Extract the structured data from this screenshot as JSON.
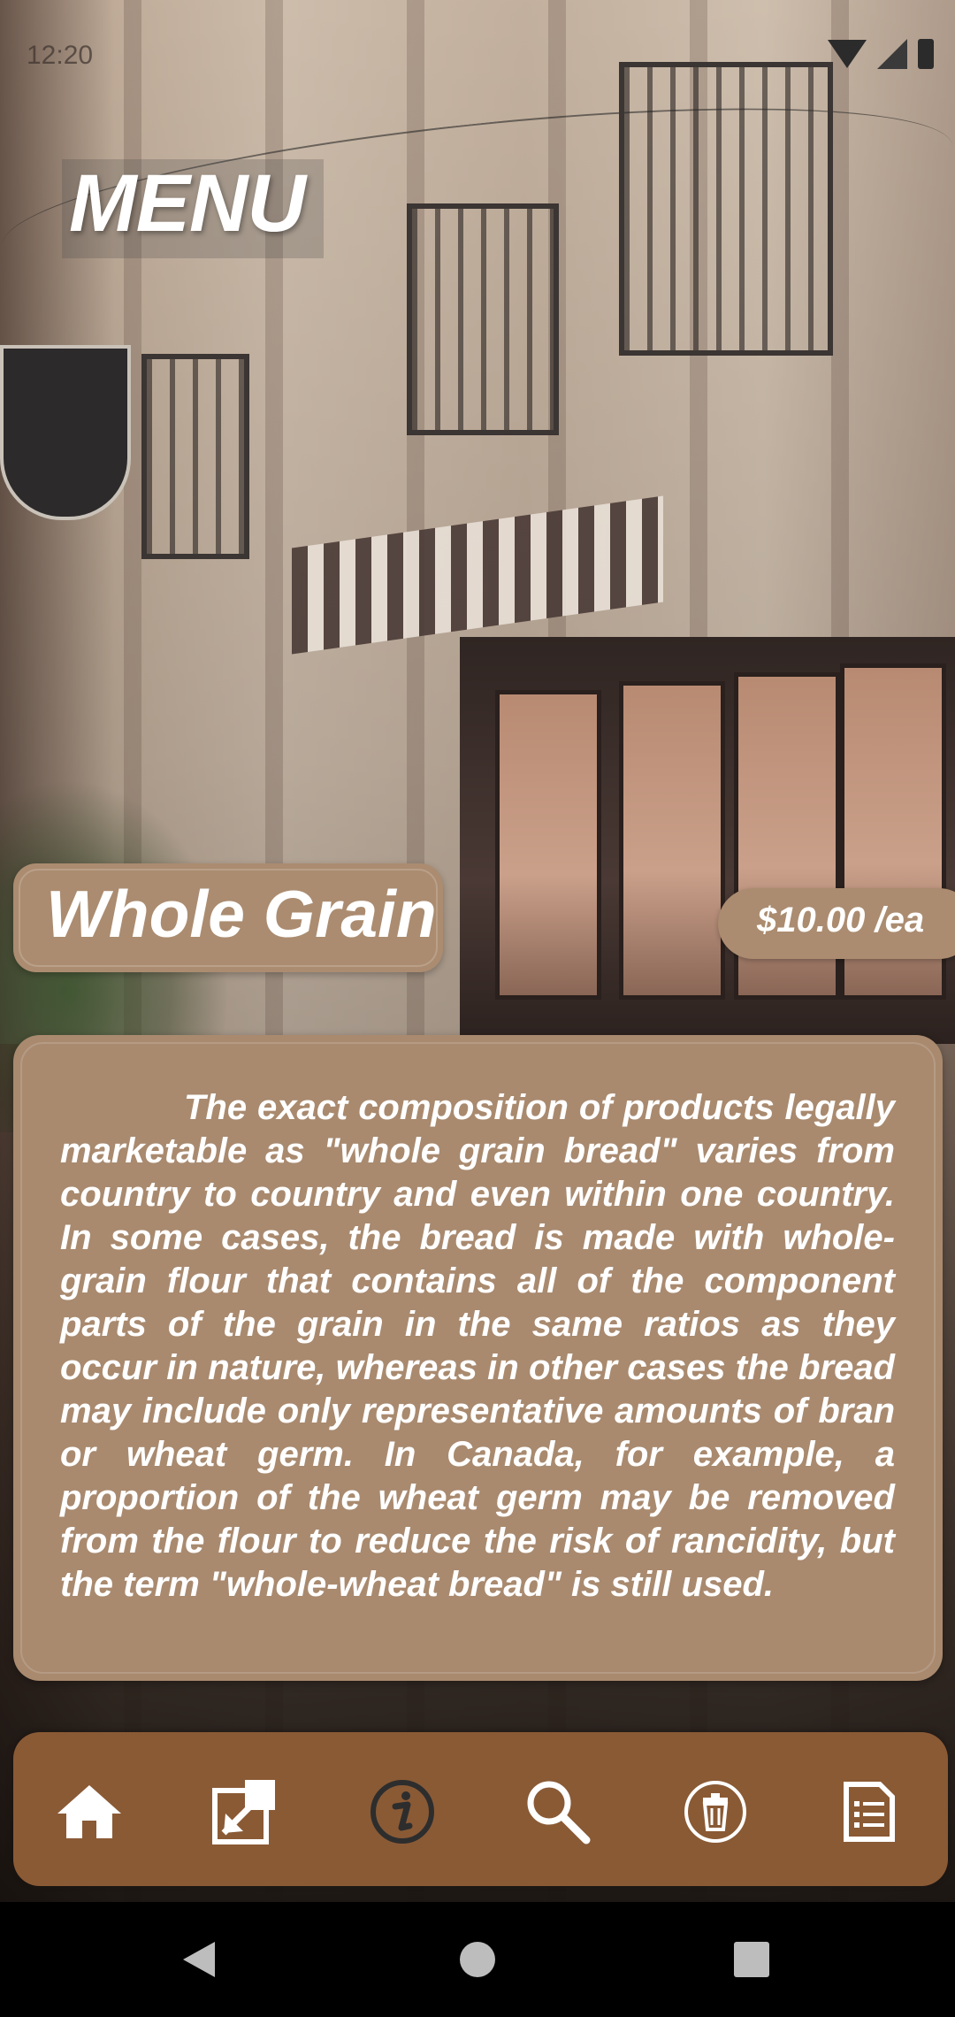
{
  "status_bar": {
    "time": "12:20",
    "icons": [
      "wifi-icon",
      "signal-icon",
      "battery-icon"
    ]
  },
  "header": {
    "title": "MENU"
  },
  "item": {
    "name": "Whole Grain",
    "price": "$10.00 /ea",
    "description": "The exact composition of products legally marketable as \"whole grain bread\" varies from country to country and even within one country. In some cases, the bread is made with whole-grain flour that contains all of the component parts of the grain in the same ratios as they occur in nature, whereas in other cases the bread may include only representative amounts of bran or wheat germ. In Canada, for example, a proportion of the wheat germ may be removed from the flour to reduce the risk of rancidity, but the term \"whole-wheat bread\" is still used."
  },
  "toolbar": {
    "buttons": [
      {
        "icon": "home-icon"
      },
      {
        "icon": "open-external-icon"
      },
      {
        "icon": "info-icon"
      },
      {
        "icon": "search-icon"
      },
      {
        "icon": "trash-icon"
      },
      {
        "icon": "checklist-icon"
      }
    ]
  },
  "nav_bar": {
    "buttons": [
      "back-icon",
      "home-circle-icon",
      "recents-icon"
    ]
  },
  "colors": {
    "pill": "#ab8c70",
    "card": "#a98a6f",
    "toolbar": "#8a5a35",
    "text": "#ffffff"
  }
}
